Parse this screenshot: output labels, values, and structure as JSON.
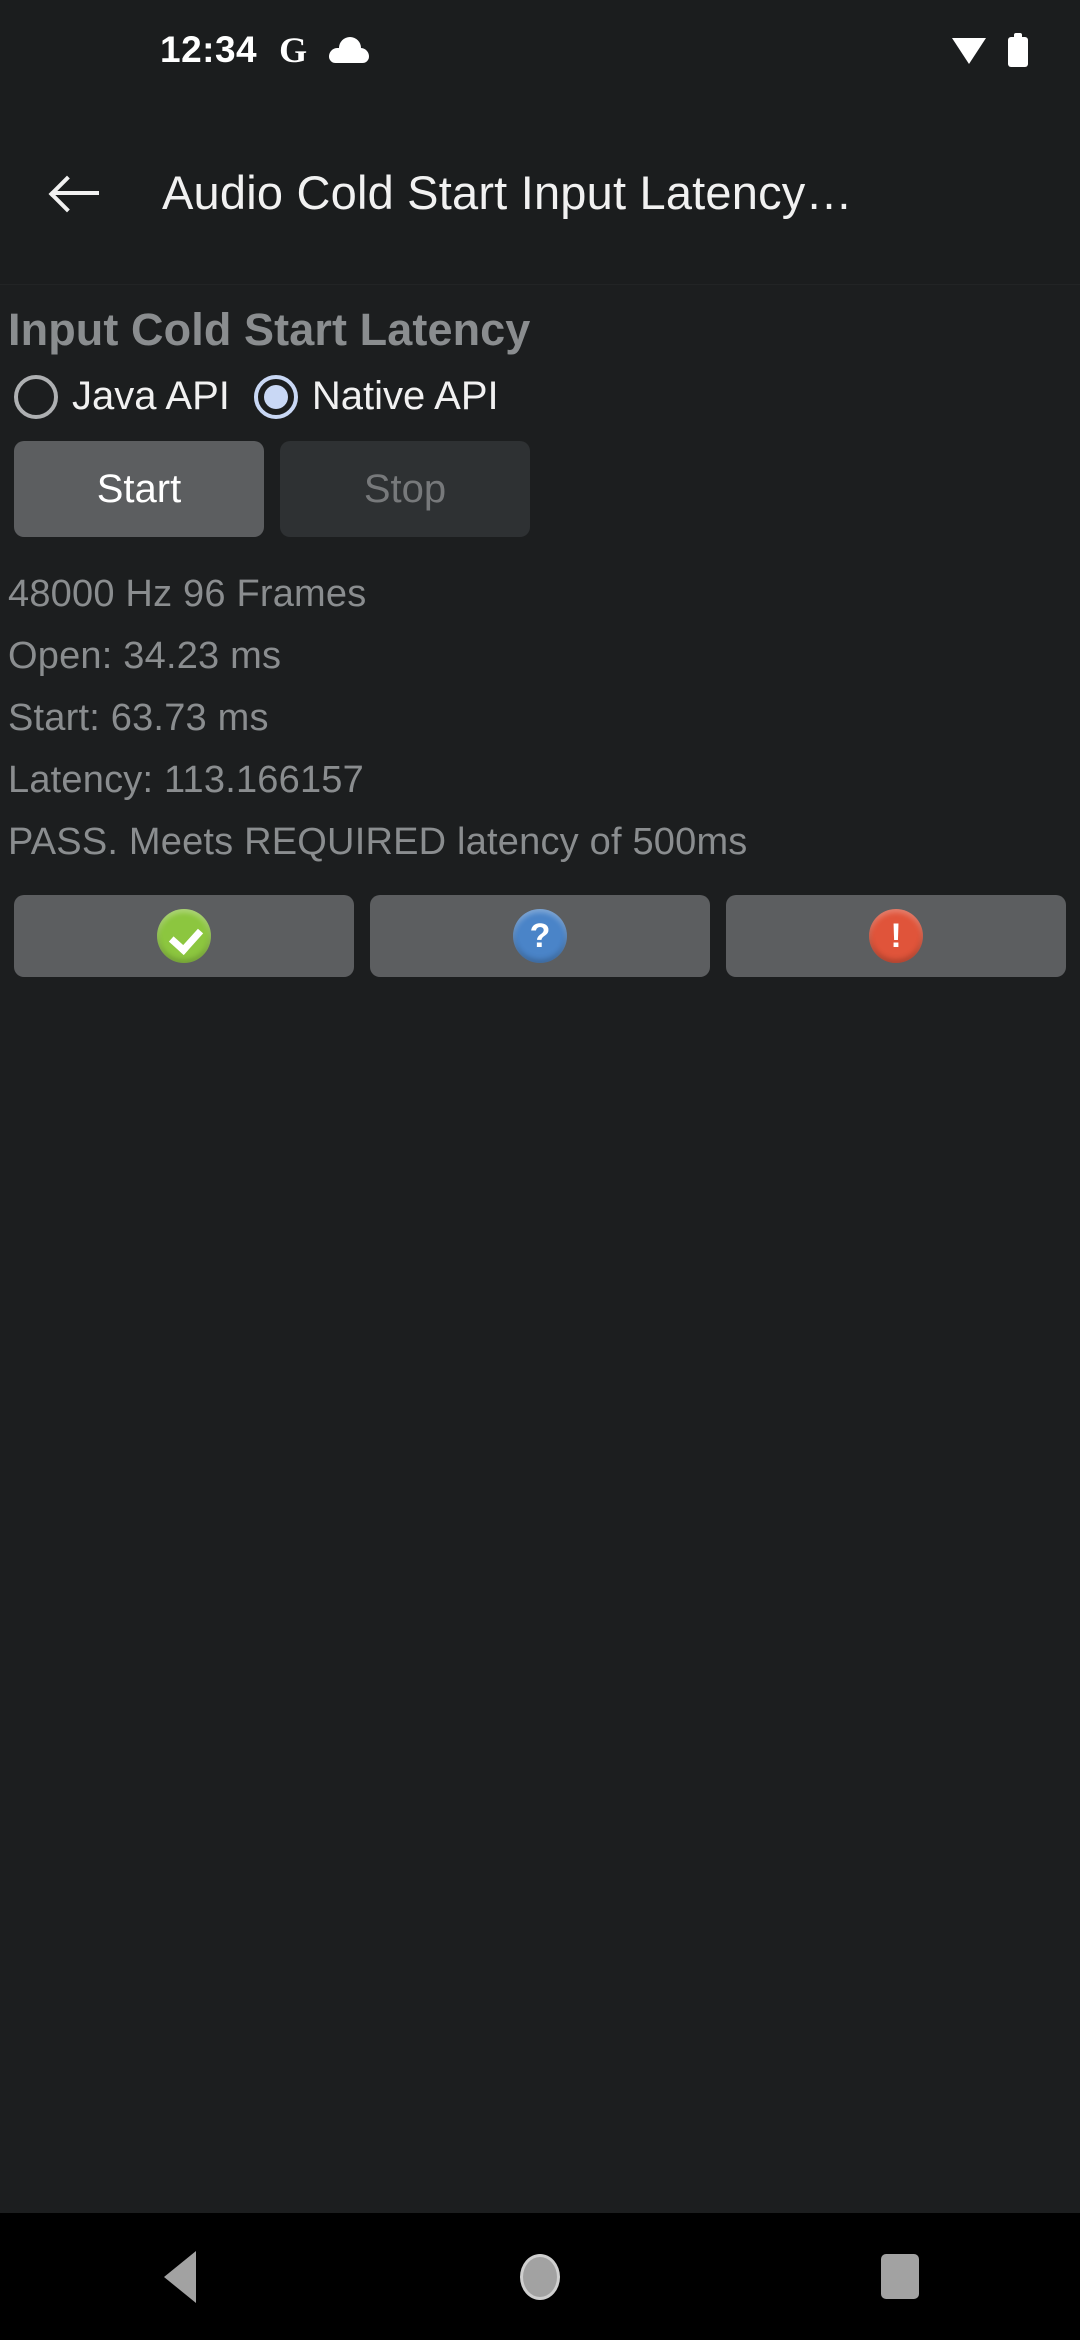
{
  "status_bar": {
    "clock": "12:34",
    "google_icon": "G",
    "cloud_icon": "cloud-icon",
    "wifi_icon": "wifi-icon",
    "battery_icon": "battery-icon"
  },
  "app_bar": {
    "back_icon": "back-arrow-icon",
    "title": "Audio Cold Start Input Latency…"
  },
  "main": {
    "section_title": "Input Cold Start Latency",
    "radio_options": [
      {
        "label": "Java API",
        "selected": false
      },
      {
        "label": "Native API",
        "selected": true
      }
    ],
    "buttons": {
      "start_label": "Start",
      "stop_label": "Stop",
      "start_enabled": true,
      "stop_enabled": false
    },
    "readout": [
      "48000 Hz 96 Frames",
      "Open: 34.23 ms",
      "Start: 63.73 ms",
      "Latency: 113.166157",
      "PASS. Meets REQUIRED latency of 500ms"
    ],
    "result_buttons": [
      {
        "icon": "pass-check-icon",
        "glyph": "",
        "color": "#8cc63f"
      },
      {
        "icon": "info-question-icon",
        "glyph": "?",
        "color": "#4a84c8"
      },
      {
        "icon": "fail-exclamation-icon",
        "glyph": "!",
        "color": "#e0543a"
      }
    ]
  },
  "nav_bar": {
    "back_label": "back-triangle-icon",
    "home_label": "home-circle-icon",
    "recents_label": "recents-square-icon"
  }
}
